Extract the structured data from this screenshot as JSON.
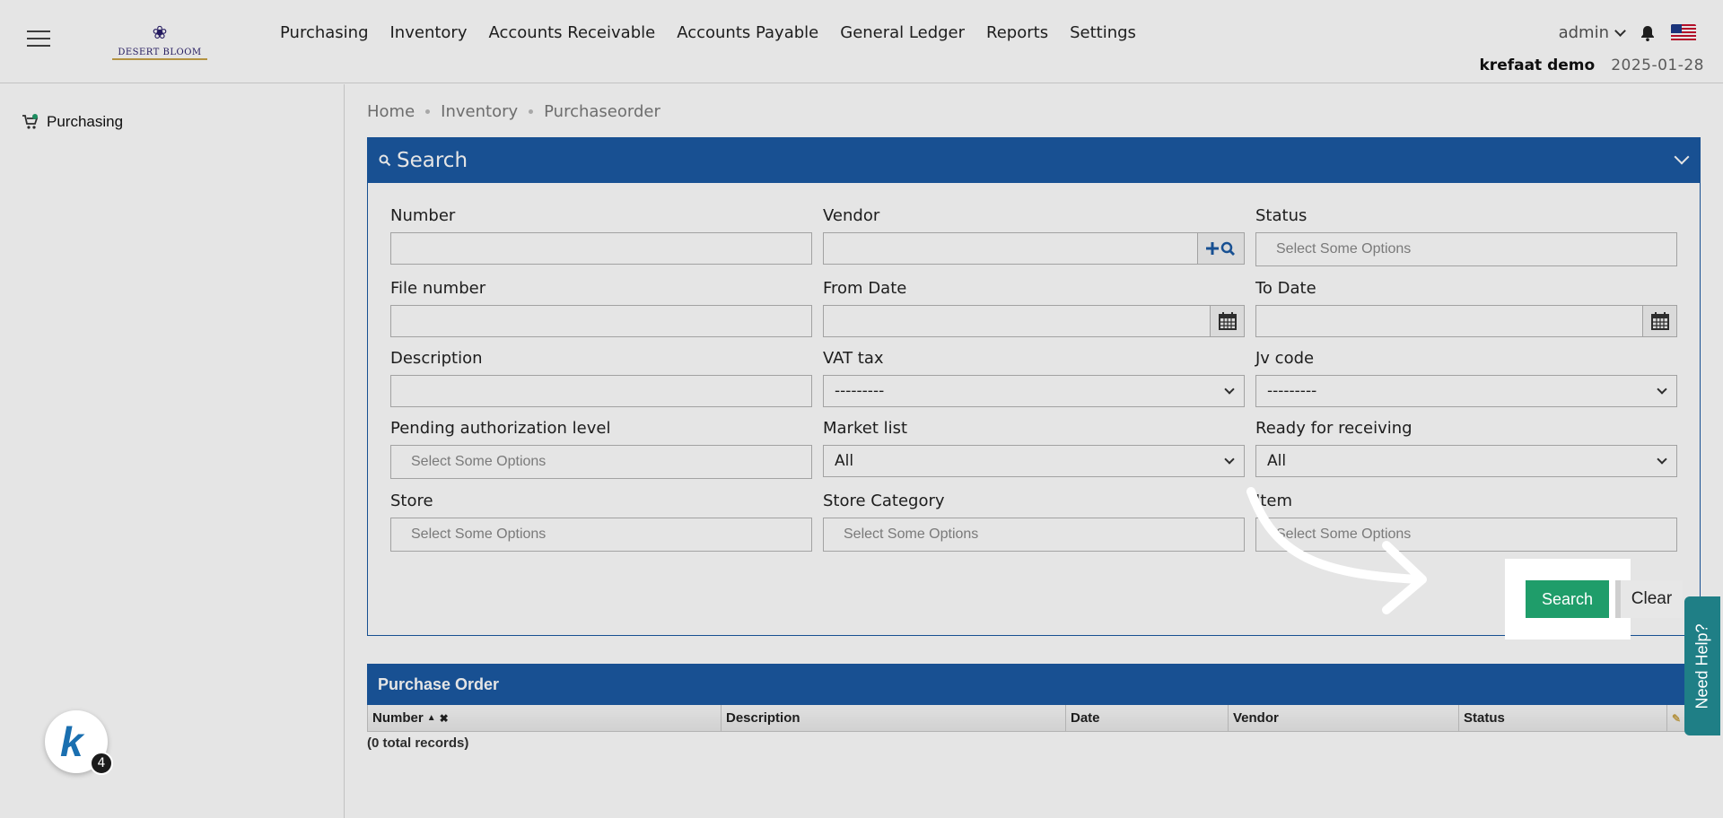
{
  "header": {
    "logo_text": "DESERT BLOOM",
    "nav": [
      "Purchasing",
      "Inventory",
      "Accounts Receivable",
      "Accounts Payable",
      "General Ledger",
      "Reports",
      "Settings"
    ],
    "user": "admin",
    "company": "krefaat demo",
    "date": "2025-01-28"
  },
  "sidebar": {
    "items": [
      {
        "label": "Purchasing",
        "icon": "cart-icon"
      }
    ]
  },
  "breadcrumb": [
    "Home",
    "Inventory",
    "Purchaseorder"
  ],
  "search_panel": {
    "title": "Search",
    "fields": {
      "number": {
        "label": "Number"
      },
      "vendor": {
        "label": "Vendor"
      },
      "status": {
        "label": "Status",
        "placeholder": "Select Some Options"
      },
      "file_number": {
        "label": "File number"
      },
      "from_date": {
        "label": "From Date"
      },
      "to_date": {
        "label": "To Date"
      },
      "description": {
        "label": "Description"
      },
      "vat_tax": {
        "label": "VAT tax",
        "value": "---------"
      },
      "jv_code": {
        "label": "Jv code",
        "value": "---------"
      },
      "pending_auth": {
        "label": "Pending authorization level",
        "placeholder": "Select Some Options"
      },
      "market_list": {
        "label": "Market list",
        "value": "All"
      },
      "ready_receiving": {
        "label": "Ready for receiving",
        "value": "All"
      },
      "store": {
        "label": "Store",
        "placeholder": "Select Some Options"
      },
      "store_category": {
        "label": "Store Category",
        "placeholder": "Select Some Options"
      },
      "item": {
        "label": "Item",
        "placeholder": "Select Some Options"
      }
    },
    "search_button": "Search",
    "clear_button": "Clear"
  },
  "results": {
    "title": "Purchase Order",
    "columns": [
      "Number",
      "Description",
      "Date",
      "Vendor",
      "Status"
    ],
    "total": "(0 total records)"
  },
  "help_tab": "Need Help?",
  "badge_count": "4",
  "colors": {
    "primary": "#1b5aa3",
    "success": "#1f9d6a",
    "help": "#1f7f86"
  }
}
